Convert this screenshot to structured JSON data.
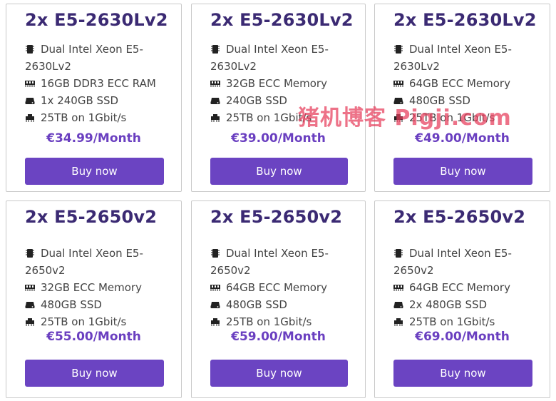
{
  "icons": {
    "cpu": "cpu-icon",
    "ram": "memory-icon",
    "disk": "disk-icon",
    "network": "network-icon"
  },
  "colors": {
    "title": "#3b2a73",
    "price": "#6a3fc0",
    "button": "#6b44c2",
    "watermark": "#e63c5a"
  },
  "watermark": "猪机博客 Pigji.com",
  "plans": [
    {
      "title": "2x E5-2630Lv2",
      "cpu": "Dual Intel Xeon E5-2630Lv2",
      "ram": "16GB DDR3 ECC RAM",
      "disk": "1x 240GB SSD",
      "network": "25TB on 1Gbit/s",
      "price": "€34.99/Month",
      "button": "Buy now"
    },
    {
      "title": "2x E5-2630Lv2",
      "cpu": "Dual Intel Xeon E5-2630Lv2",
      "ram": "32GB ECC Memory",
      "disk": "240GB SSD",
      "network": "25TB on 1Gbit/s",
      "price": "€39.00/Month",
      "button": "Buy now"
    },
    {
      "title": "2x E5-2630Lv2",
      "cpu": "Dual Intel Xeon E5-2630Lv2",
      "ram": "64GB ECC Memory",
      "disk": "480GB SSD",
      "network": "25TB on 1Gbit/s",
      "price": "€49.00/Month",
      "button": "Buy now"
    },
    {
      "title": "2x E5-2650v2",
      "cpu": "Dual Intel Xeon E5-2650v2",
      "ram": "32GB ECC Memory",
      "disk": "480GB SSD",
      "network": "25TB on 1Gbit/s",
      "price": "€55.00/Month",
      "button": "Buy now"
    },
    {
      "title": "2x E5-2650v2",
      "cpu": "Dual Intel Xeon E5-2650v2",
      "ram": "64GB ECC Memory",
      "disk": "480GB SSD",
      "network": "25TB on 1Gbit/s",
      "price": "€59.00/Month",
      "button": "Buy now"
    },
    {
      "title": "2x E5-2650v2",
      "cpu": "Dual Intel Xeon E5-2650v2",
      "ram": "64GB ECC Memory",
      "disk": "2x 480GB SSD",
      "network": "25TB on 1Gbit/s",
      "price": "€69.00/Month",
      "button": "Buy now"
    }
  ]
}
